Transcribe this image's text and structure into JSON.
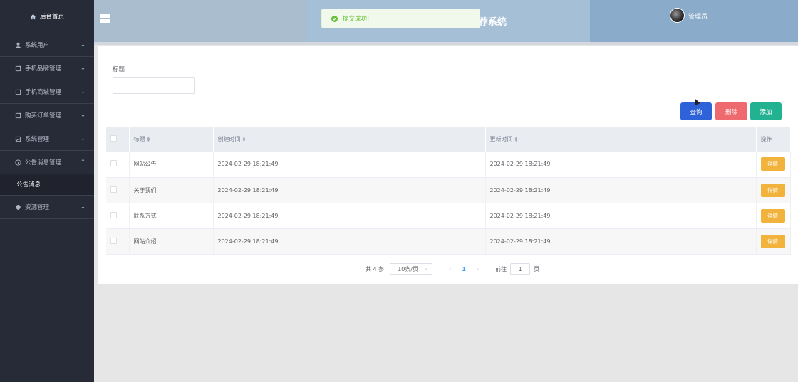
{
  "sidebar": {
    "home": "后台首页",
    "items": [
      {
        "label": "系统用户",
        "icon": "user-icon",
        "chevron": "⌄"
      },
      {
        "label": "手机品牌管理",
        "icon": "document-icon",
        "chevron": "⌄"
      },
      {
        "label": "手机商城管理",
        "icon": "document-icon",
        "chevron": "⌄"
      },
      {
        "label": "购买订单管理",
        "icon": "document-icon",
        "chevron": "⌄"
      },
      {
        "label": "系统管理",
        "icon": "image-icon",
        "chevron": "⌄"
      },
      {
        "label": "公告消息管理",
        "icon": "info-icon",
        "chevron": "⌃"
      },
      {
        "label": "资源管理",
        "icon": "shield-icon",
        "chevron": "⌄"
      }
    ],
    "sub_item": "公告消息"
  },
  "header": {
    "title_fragment": "荐系统",
    "admin": "管理员"
  },
  "toast": {
    "message": "提交成功!"
  },
  "search": {
    "label": "标题",
    "value": ""
  },
  "buttons": {
    "query": "查询",
    "delete": "删除",
    "add": "添加"
  },
  "table": {
    "headers": {
      "title": "标题",
      "created": "创建时间",
      "updated": "更新时间",
      "action": "操作"
    },
    "rows": [
      {
        "title": "网站公告",
        "created": "2024-02-29 18:21:49",
        "updated": "2024-02-29 18:21:49",
        "action": "详情"
      },
      {
        "title": "关于我们",
        "created": "2024-02-29 18:21:49",
        "updated": "2024-02-29 18:21:49",
        "action": "详情"
      },
      {
        "title": "联系方式",
        "created": "2024-02-29 18:21:49",
        "updated": "2024-02-29 18:21:49",
        "action": "详情"
      },
      {
        "title": "网站介绍",
        "created": "2024-02-29 18:21:49",
        "updated": "2024-02-29 18:21:49",
        "action": "详情"
      }
    ]
  },
  "pagination": {
    "total": "共 4 条",
    "page_size": "10条/页",
    "current_page": "1",
    "goto_label": "前往",
    "goto_value": "1",
    "page_unit": "页"
  },
  "colors": {
    "sidebar": "#272b38",
    "query": "#2d62d8",
    "delete": "#ef6a6e",
    "add": "#22b291",
    "detail": "#f2b33d",
    "success": "#67c23a"
  }
}
